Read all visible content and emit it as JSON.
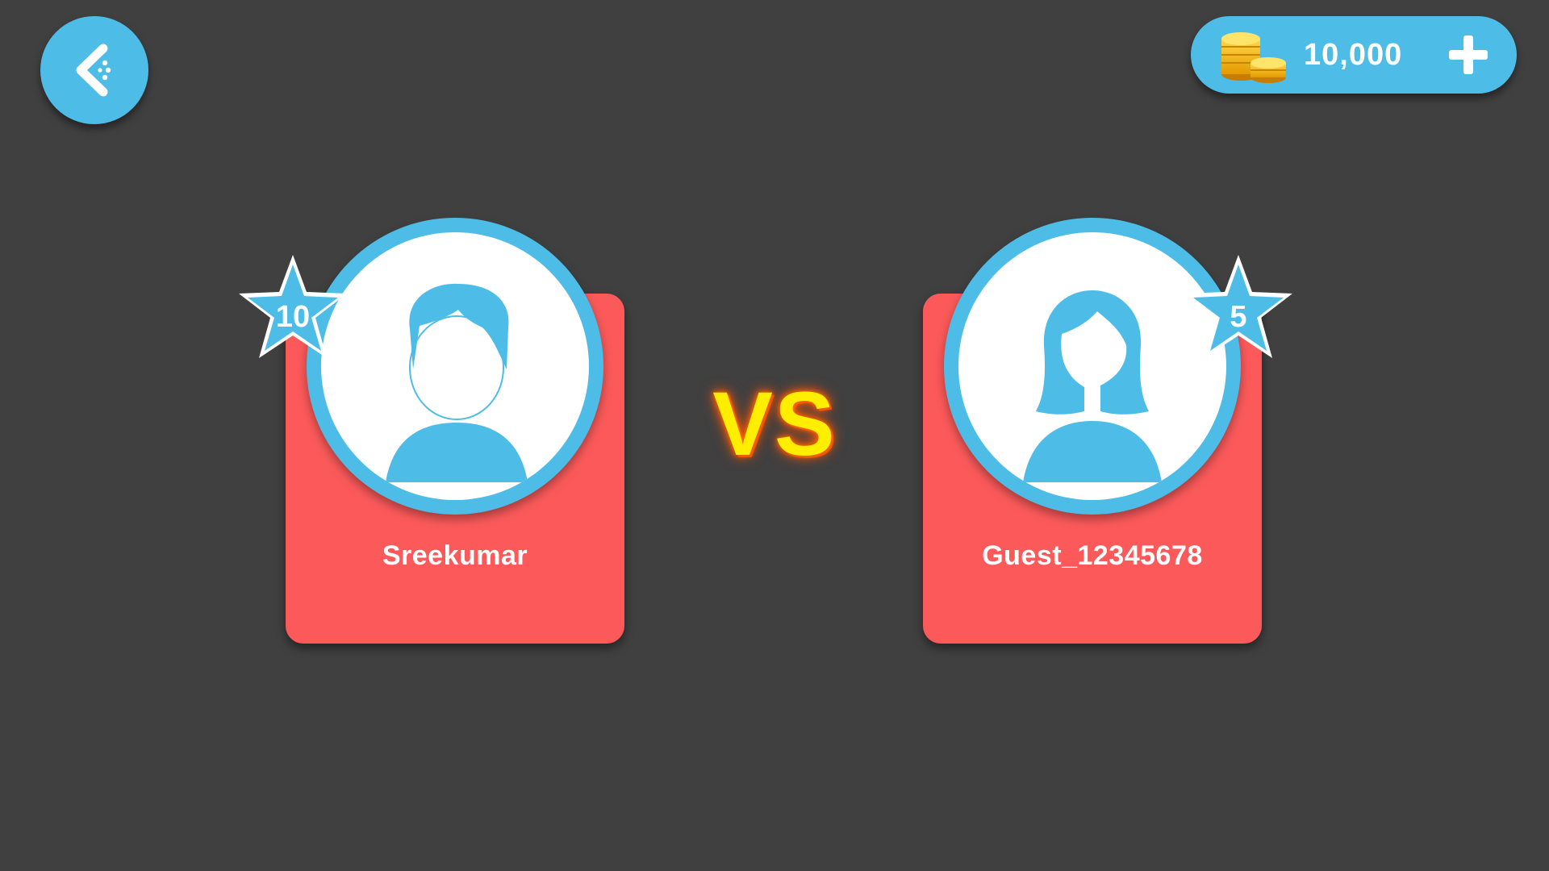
{
  "header": {
    "back_icon": "back-chevron-icon",
    "coins": {
      "icon": "gold-coins-icon",
      "value": "10,000",
      "add_icon": "plus-icon"
    }
  },
  "match": {
    "vs_label": "VS",
    "players": [
      {
        "name": "Sreekumar",
        "level": "10",
        "avatar": "male-avatar-icon"
      },
      {
        "name": "Guest_12345678",
        "level": "5",
        "avatar": "female-avatar-icon"
      }
    ]
  },
  "colors": {
    "background": "#404040",
    "accent_blue": "#4dbde8",
    "card_red": "#fc5a5a",
    "vs_yellow": "#ffee00",
    "vs_glow": "#ff6a00",
    "text_white": "#ffffff"
  }
}
